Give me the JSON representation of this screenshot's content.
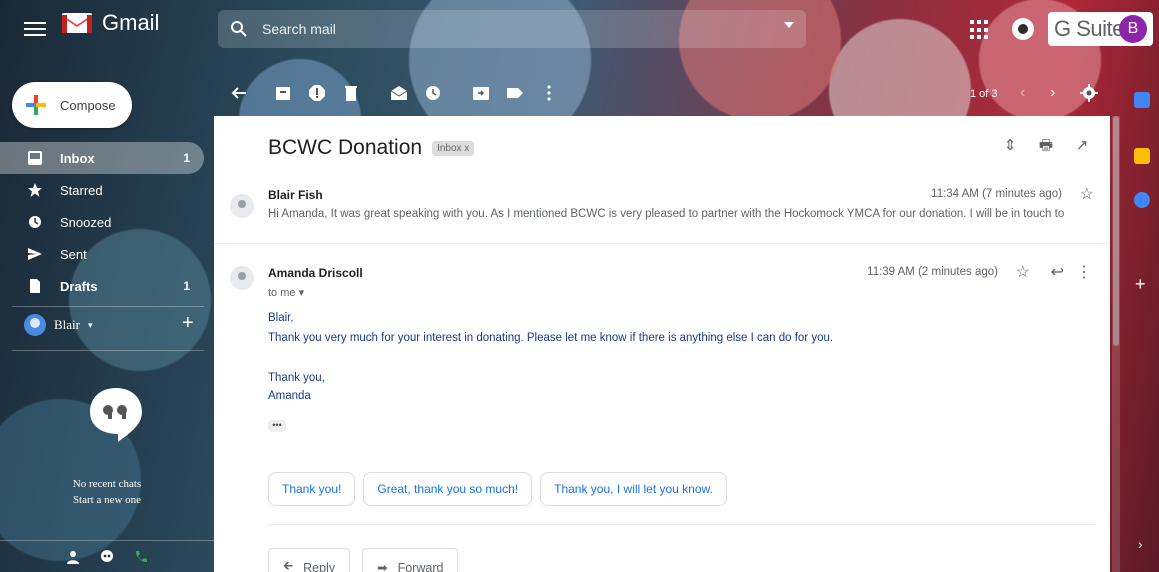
{
  "app": {
    "name": "Gmail",
    "suite": "G Suite",
    "avatar_letter": "B"
  },
  "search": {
    "placeholder": "Search mail"
  },
  "compose": {
    "label": "Compose"
  },
  "nav": [
    {
      "name": "inbox",
      "label": "Inbox",
      "count": "1",
      "icon": "inbox-icon"
    },
    {
      "name": "starred",
      "label": "Starred",
      "count": "",
      "icon": "star-icon"
    },
    {
      "name": "snoozed",
      "label": "Snoozed",
      "count": "",
      "icon": "clock-icon"
    },
    {
      "name": "sent",
      "label": "Sent",
      "count": "",
      "icon": "send-icon"
    },
    {
      "name": "drafts",
      "label": "Drafts",
      "count": "1",
      "icon": "draft-icon"
    }
  ],
  "chat": {
    "user": "Blair",
    "no_chats": "No recent chats",
    "start_new": "Start a new one"
  },
  "toolbar": {
    "pager": "1 of 3"
  },
  "email": {
    "subject": "BCWC Donation",
    "label_chip": "Inbox x",
    "messages": [
      {
        "sender": "Blair Fish",
        "timestamp": "11:34 AM (7 minutes ago)",
        "snippet": "Hi Amanda, It was great speaking with you. As I mentioned BCWC is very pleased to partner with the Hockomock YMCA for our donation. I will be in touch to let yo"
      },
      {
        "sender": "Amanda Driscoll",
        "timestamp": "11:39 AM (2 minutes ago)",
        "to": "to me",
        "body": [
          "Blair,",
          "Thank you very much for your interest in donating. Please let me know if there is anything else I can do for you.",
          "Thank you,",
          "Amanda"
        ]
      }
    ],
    "smart_replies": [
      "Thank you!",
      "Great, thank you so much!",
      "Thank you, I will let you know."
    ],
    "reply_label": "Reply",
    "forward_label": "Forward"
  },
  "colors": {
    "accent": "#1a73e8",
    "gmail_red": "#ea4335",
    "avatar": "#8e24aa"
  }
}
